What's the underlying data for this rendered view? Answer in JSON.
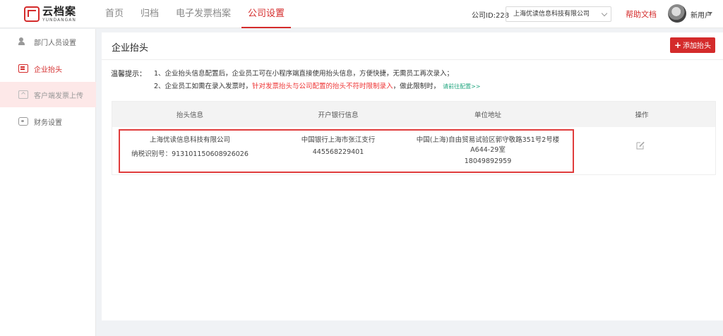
{
  "logo": {
    "cn": "云档案",
    "en": "YUNDANGAN"
  },
  "nav": [
    {
      "label": "首页"
    },
    {
      "label": "归档"
    },
    {
      "label": "电子发票档案"
    },
    {
      "label": "公司设置"
    }
  ],
  "header": {
    "company_id": "公司ID:228",
    "company_name": "上海优读信息科技有限公司",
    "help": "帮助文档",
    "user": "新用户"
  },
  "sidebar": {
    "items": [
      {
        "label": "部门人员设置",
        "icon": "people-icon"
      },
      {
        "label": "企业抬头",
        "icon": "invoice-head-icon"
      },
      {
        "label": "客户端发票上传",
        "icon": "upload-icon"
      },
      {
        "label": "财务设置",
        "icon": "finance-icon"
      }
    ]
  },
  "panel": {
    "title": "企业抬头",
    "add_button": "添加抬头",
    "tips_label": "温馨提示：",
    "tip1": "1、企业抬头信息配置后，企业员工可在小程序端直接使用抬头信息，方便快捷，无需员工再次录入；",
    "tip2_before": "2、企业员工如需在录入发票时，",
    "tip2_red": "针对发票抬头与公司配置的抬头不符时限制录入",
    "tip2_after": "，做此限制时，",
    "tip2_link": "请前往配置>>"
  },
  "table": {
    "columns": [
      "抬头信息",
      "开户银行信息",
      "单位地址",
      "操作"
    ],
    "rows": [
      {
        "company": "上海优读信息科技有限公司",
        "tax_id": "纳税识别号：913101150608926026",
        "bank": "中国银行上海市张江支行",
        "account": "445568229401",
        "address_line1": "中国(上海)自由贸易试验区郭守敬路351号2号楼",
        "address_line2": "A644-29室",
        "phone": "18049892959"
      }
    ]
  },
  "colors": {
    "accent": "#d42b2b",
    "link_green": "#22a67f"
  }
}
